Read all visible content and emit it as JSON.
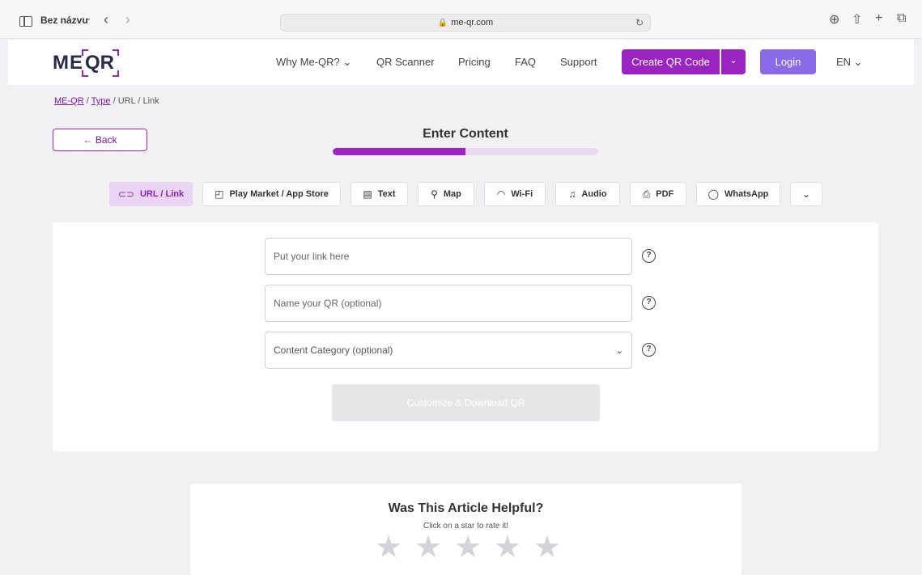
{
  "browser": {
    "tab_title": "Bez názvu",
    "url": "me-qr.com"
  },
  "header": {
    "logo_text_me": "ME",
    "logo_text_qr": "QR",
    "nav": [
      "Why Me-QR?",
      "QR Scanner",
      "Pricing",
      "FAQ",
      "Support"
    ],
    "create_button": "Create QR Code",
    "login_button": "Login",
    "language": "EN"
  },
  "breadcrumb": {
    "root": "ME-QR",
    "type": "Type",
    "rest": "/ URL / Link"
  },
  "back_button": "← Back",
  "step": {
    "title": "Enter Content",
    "progress_fraction": 0.5
  },
  "type_tabs": [
    {
      "label": "URL / Link",
      "icon": "link-icon",
      "active": true
    },
    {
      "label": "Play Market / App Store",
      "icon": "app-store-icon",
      "active": false
    },
    {
      "label": "Text",
      "icon": "text-icon",
      "active": false
    },
    {
      "label": "Map",
      "icon": "map-pin-icon",
      "active": false
    },
    {
      "label": "Wi-Fi",
      "icon": "wifi-icon",
      "active": false
    },
    {
      "label": "Audio",
      "icon": "music-note-icon",
      "active": false
    },
    {
      "label": "PDF",
      "icon": "pdf-icon",
      "active": false
    },
    {
      "label": "WhatsApp",
      "icon": "whatsapp-icon",
      "active": false
    }
  ],
  "form": {
    "link_placeholder": "Put your link here",
    "name_placeholder": "Name your QR (optional)",
    "category_placeholder": "Content Category (optional)",
    "help_glyph": "?",
    "submit_button": "Customize & Download QR"
  },
  "rating": {
    "title": "Was This Article Helpful?",
    "subtitle": "Click on a star to rate it!",
    "stars_total": 5
  },
  "colors": {
    "brand_purple": "#9b23c2",
    "login_violet": "#8a6be8",
    "active_tab_bg": "#ead4f3"
  }
}
